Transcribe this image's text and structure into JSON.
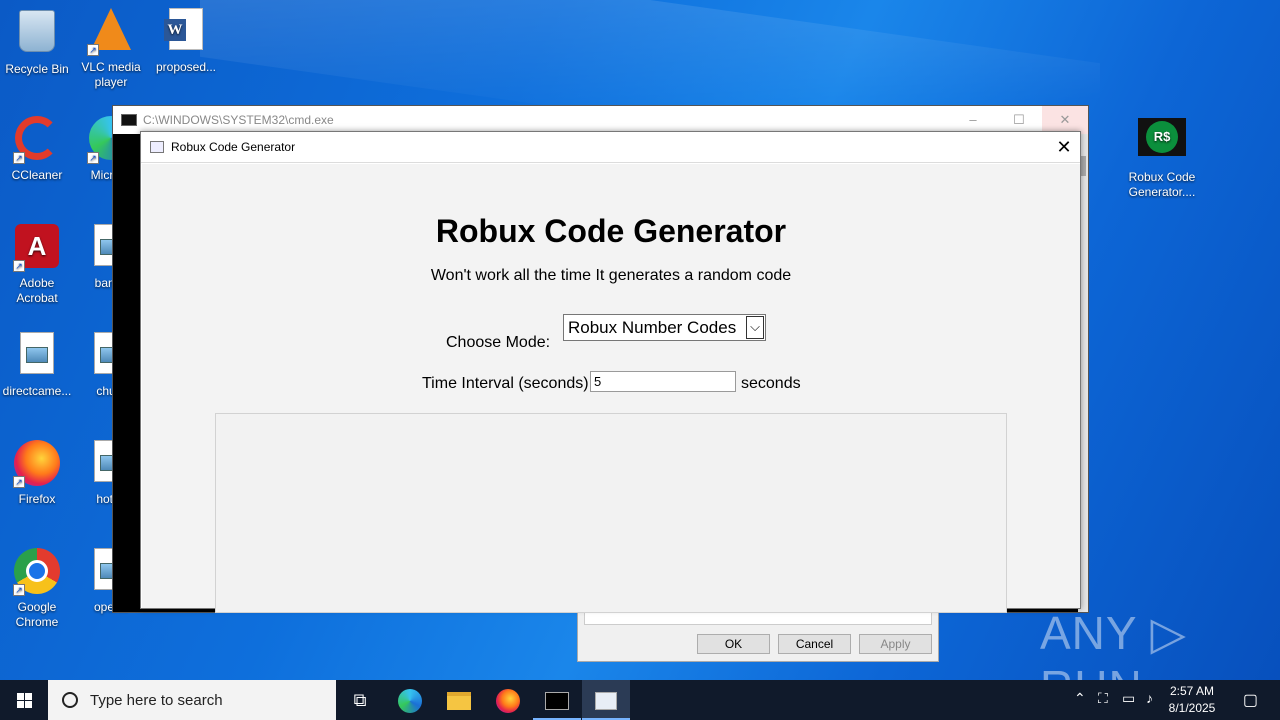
{
  "desktop": {
    "icons": [
      {
        "label": "Recycle Bin"
      },
      {
        "label": "VLC media player"
      },
      {
        "label": "proposed..."
      },
      {
        "label": "CCleaner"
      },
      {
        "label": "Micr Ed"
      },
      {
        "label": "Adobe Acrobat"
      },
      {
        "label": "banke"
      },
      {
        "label": "directcame..."
      },
      {
        "label": "churc"
      },
      {
        "label": "Firefox"
      },
      {
        "label": "hotelt"
      },
      {
        "label": "Google Chrome"
      },
      {
        "label": "operat"
      },
      {
        "label": "Robux Code Generator...."
      }
    ]
  },
  "cmd_window": {
    "title": "C:\\WINDOWS\\SYSTEM32\\cmd.exe",
    "min": "–",
    "max": "☐",
    "close": "✕"
  },
  "app_window": {
    "title": "Robux Code Generator",
    "close": "✕",
    "heading": "Robux Code Generator",
    "subtitle": "Won't work all the time It generates a random code",
    "mode_label": "Choose Mode:",
    "mode_value": "Robux Number Codes",
    "interval_label": "Time Interval (seconds):",
    "interval_value": "5",
    "interval_unit": "seconds"
  },
  "background_dialog": {
    "ok": "OK",
    "cancel": "Cancel",
    "apply": "Apply"
  },
  "watermark": "ANY ▷ RUN",
  "taskbar": {
    "search_placeholder": "Type here to search",
    "time": "2:57 AM",
    "date": "8/1/2025"
  }
}
